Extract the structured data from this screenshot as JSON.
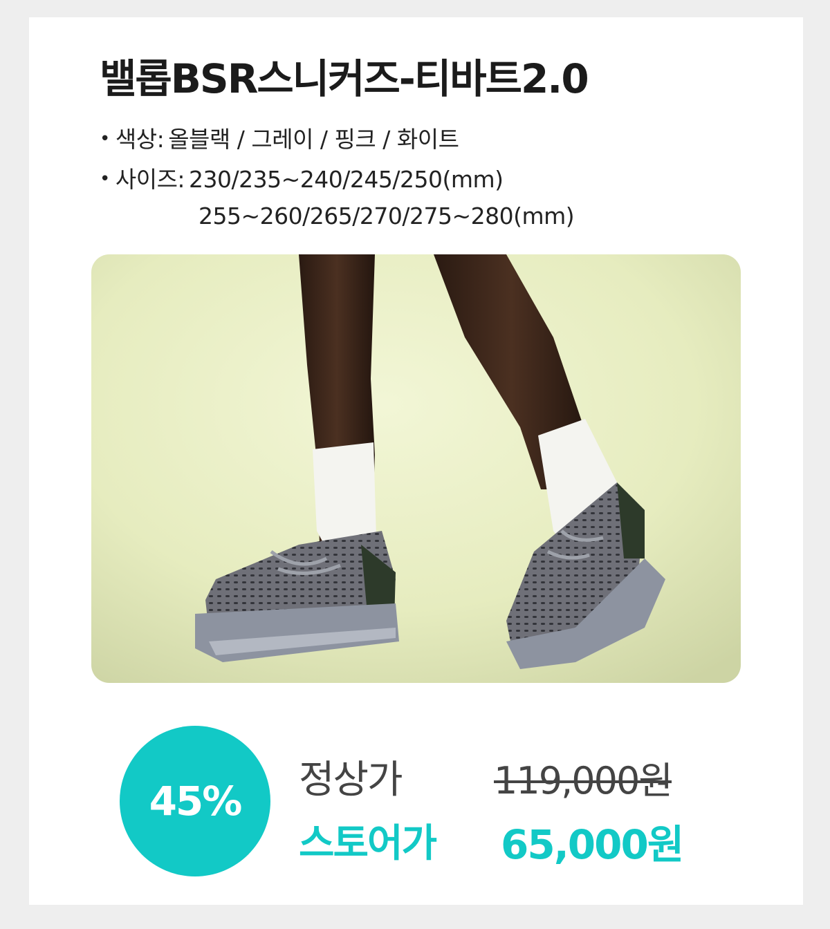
{
  "product": {
    "title": "밸롭BSR스니커즈-티바트2.0",
    "bullet": "•",
    "color_label": "색상:",
    "color_value": "올블랙 / 그레이 / 핑크 / 화이트",
    "size_label": "사이즈:",
    "size_line1": "230/235~240/245/250(mm)",
    "size_line2": "255~260/265/270/275~280(mm)"
  },
  "pricing": {
    "discount_badge": "45%",
    "regular_label": "정상가",
    "regular_price": "119,000원",
    "store_label": "스토어가",
    "store_price": "65,000원"
  },
  "colors": {
    "accent": "#12c9c6",
    "background": "#eeeeee",
    "card": "#ffffff"
  },
  "image": {
    "subject": "legs wearing white socks and grey knit sneakers"
  }
}
